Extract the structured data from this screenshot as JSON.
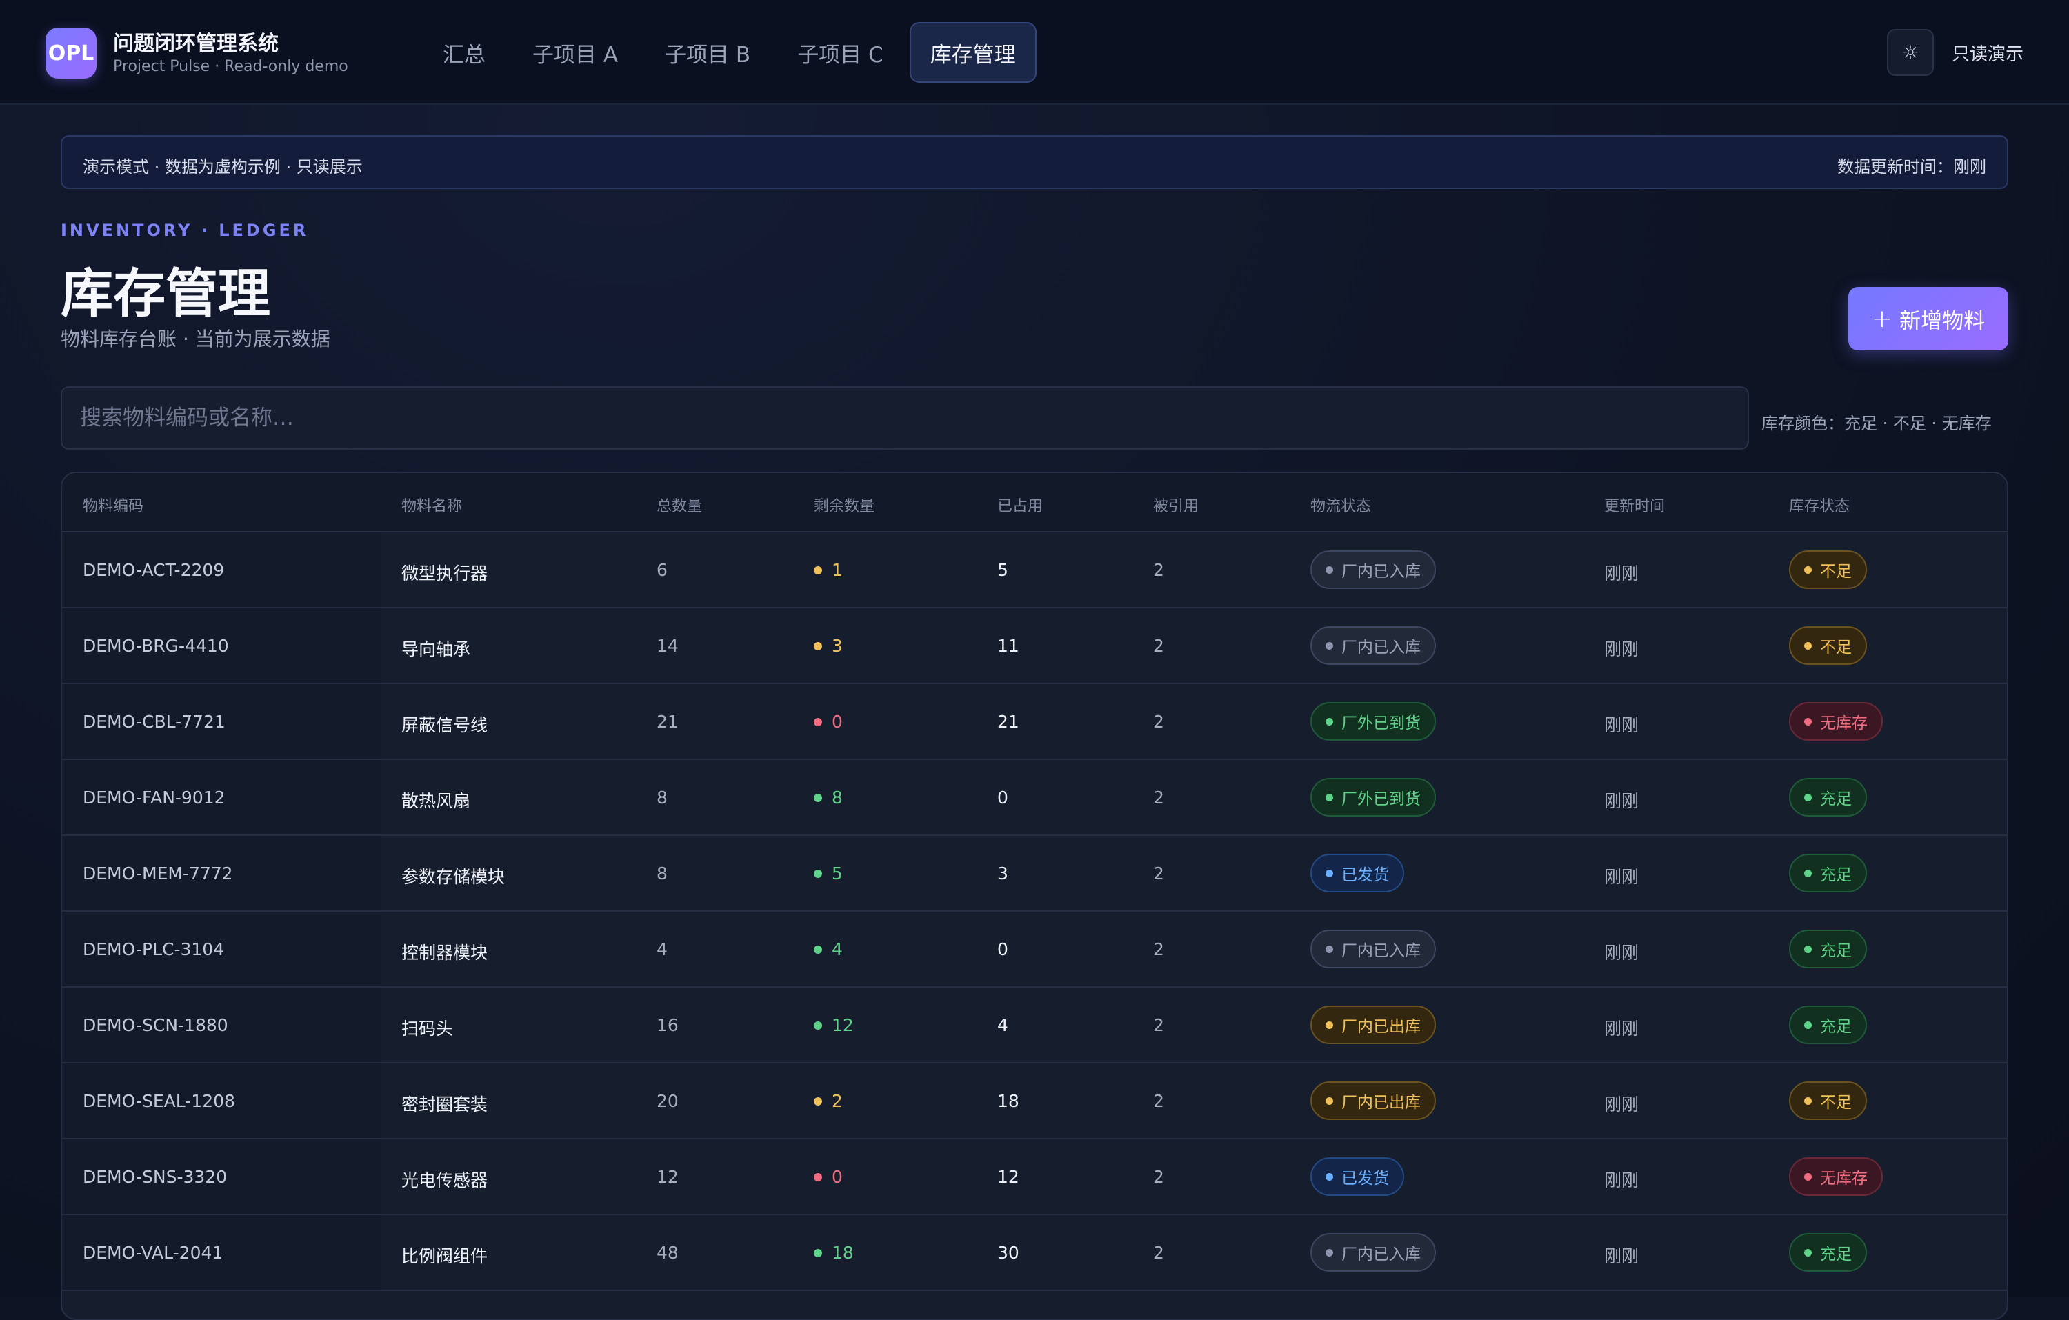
{
  "app": {
    "logo": "OPL",
    "title": "问题闭环管理系统",
    "subtitle": "Project Pulse · Read-only demo"
  },
  "nav": {
    "tabs": [
      {
        "label": "汇总",
        "active": false
      },
      {
        "label": "子项目 A",
        "active": false
      },
      {
        "label": "子项目 B",
        "active": false
      },
      {
        "label": "子项目 C",
        "active": false
      },
      {
        "label": "库存管理",
        "active": true
      }
    ],
    "theme_icon": "sun-icon",
    "readonly_label": "只读演示"
  },
  "banner": {
    "left": "演示模式 · 数据为虚构示例 · 只读展示",
    "right": "数据更新时间：刚刚"
  },
  "header": {
    "eyebrow": "INVENTORY · LEDGER",
    "title": "库存管理",
    "subtitle": "物料库存台账 · 当前为展示数据",
    "add_button": "新增物料"
  },
  "search": {
    "placeholder": "搜索物料编码或名称…",
    "value": "",
    "legend": "库存颜色：充足 · 不足 · 无库存"
  },
  "colors": {
    "accent": "#7479ff",
    "sufficient": "#5fd38a",
    "insufficient": "#f0c05a",
    "none": "#f06c80",
    "shipped": "#6aaefc",
    "neutral": "#9aa3b8"
  },
  "table": {
    "columns": [
      "物料编码",
      "物料名称",
      "总数量",
      "剩余数量",
      "已占用",
      "被引用",
      "物流状态",
      "更新时间",
      "库存状态"
    ],
    "rows": [
      {
        "code": "DEMO-ACT-2209",
        "name": "微型执行器",
        "total": "6",
        "remain": "1",
        "remain_level": "amber",
        "used": "5",
        "ref": "2",
        "logistics": "厂内已入库",
        "logistics_tone": "gray",
        "time": "刚刚",
        "stock": "不足",
        "stock_tone": "amber"
      },
      {
        "code": "DEMO-BRG-4410",
        "name": "导向轴承",
        "total": "14",
        "remain": "3",
        "remain_level": "amber",
        "used": "11",
        "ref": "2",
        "logistics": "厂内已入库",
        "logistics_tone": "gray",
        "time": "刚刚",
        "stock": "不足",
        "stock_tone": "amber"
      },
      {
        "code": "DEMO-CBL-7721",
        "name": "屏蔽信号线",
        "total": "21",
        "remain": "0",
        "remain_level": "red",
        "used": "21",
        "ref": "2",
        "logistics": "厂外已到货",
        "logistics_tone": "green",
        "time": "刚刚",
        "stock": "无库存",
        "stock_tone": "red"
      },
      {
        "code": "DEMO-FAN-9012",
        "name": "散热风扇",
        "total": "8",
        "remain": "8",
        "remain_level": "green",
        "used": "0",
        "ref": "2",
        "logistics": "厂外已到货",
        "logistics_tone": "green",
        "time": "刚刚",
        "stock": "充足",
        "stock_tone": "green"
      },
      {
        "code": "DEMO-MEM-7772",
        "name": "参数存储模块",
        "total": "8",
        "remain": "5",
        "remain_level": "green",
        "used": "3",
        "ref": "2",
        "logistics": "已发货",
        "logistics_tone": "blue",
        "time": "刚刚",
        "stock": "充足",
        "stock_tone": "green"
      },
      {
        "code": "DEMO-PLC-3104",
        "name": "控制器模块",
        "total": "4",
        "remain": "4",
        "remain_level": "green",
        "used": "0",
        "ref": "2",
        "logistics": "厂内已入库",
        "logistics_tone": "gray",
        "time": "刚刚",
        "stock": "充足",
        "stock_tone": "green"
      },
      {
        "code": "DEMO-SCN-1880",
        "name": "扫码头",
        "total": "16",
        "remain": "12",
        "remain_level": "green",
        "used": "4",
        "ref": "2",
        "logistics": "厂内已出库",
        "logistics_tone": "amber",
        "time": "刚刚",
        "stock": "充足",
        "stock_tone": "green"
      },
      {
        "code": "DEMO-SEAL-1208",
        "name": "密封圈套装",
        "total": "20",
        "remain": "2",
        "remain_level": "amber",
        "used": "18",
        "ref": "2",
        "logistics": "厂内已出库",
        "logistics_tone": "amber",
        "time": "刚刚",
        "stock": "不足",
        "stock_tone": "amber"
      },
      {
        "code": "DEMO-SNS-3320",
        "name": "光电传感器",
        "total": "12",
        "remain": "0",
        "remain_level": "red",
        "used": "12",
        "ref": "2",
        "logistics": "已发货",
        "logistics_tone": "blue",
        "time": "刚刚",
        "stock": "无库存",
        "stock_tone": "red"
      },
      {
        "code": "DEMO-VAL-2041",
        "name": "比例阀组件",
        "total": "48",
        "remain": "18",
        "remain_level": "green",
        "used": "30",
        "ref": "2",
        "logistics": "厂内已入库",
        "logistics_tone": "gray",
        "time": "刚刚",
        "stock": "充足",
        "stock_tone": "green"
      }
    ]
  }
}
